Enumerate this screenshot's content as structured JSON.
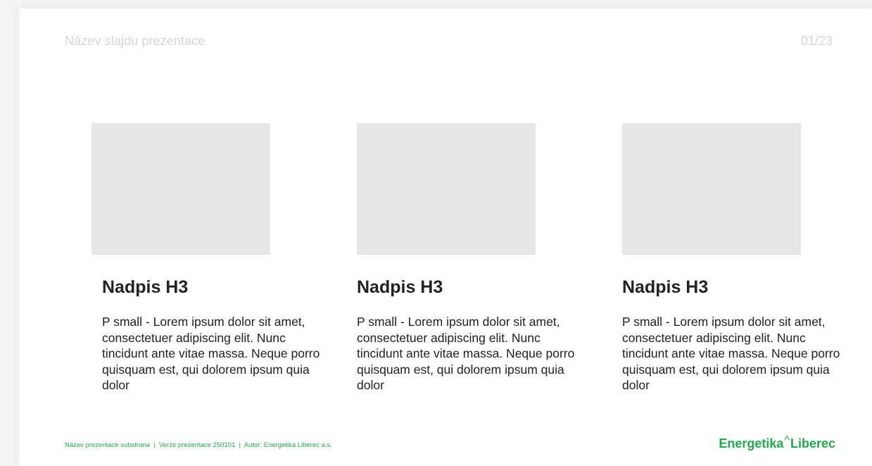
{
  "slide": {
    "title": "Název slajdu prezentace",
    "page_number": "01/23"
  },
  "cards": [
    {
      "heading": "Nadpis H3",
      "text": "P small - Lorem ipsum dolor sit amet, consectetuer adipiscing elit. Nunc tincidunt ante vitae massa. Neque porro quisquam est, qui dolorem ipsum quia dolor"
    },
    {
      "heading": "Nadpis H3",
      "text": "P small - Lorem ipsum dolor sit amet, consectetuer adipiscing elit. Nunc tincidunt ante vitae massa. Neque porro quisquam est, qui dolorem ipsum quia dolor"
    },
    {
      "heading": "Nadpis H3",
      "text": "P small - Lorem ipsum dolor sit amet, consectetuer adipiscing elit. Nunc tincidunt ante vitae massa. Neque porro quisquam est, qui dolorem ipsum quia dolor"
    }
  ],
  "footer": {
    "info": "Název prezentace substrana  |  Verze prezentace 250101  |  Autor: Energetika Liberec a.s.",
    "logo_part1": "Energetika",
    "logo_caret": "^",
    "logo_part2": "Liberec"
  },
  "colors": {
    "accent": "#1fa94b",
    "placeholder": "#e6e6e6",
    "muted_text": "#d6d6d6"
  }
}
